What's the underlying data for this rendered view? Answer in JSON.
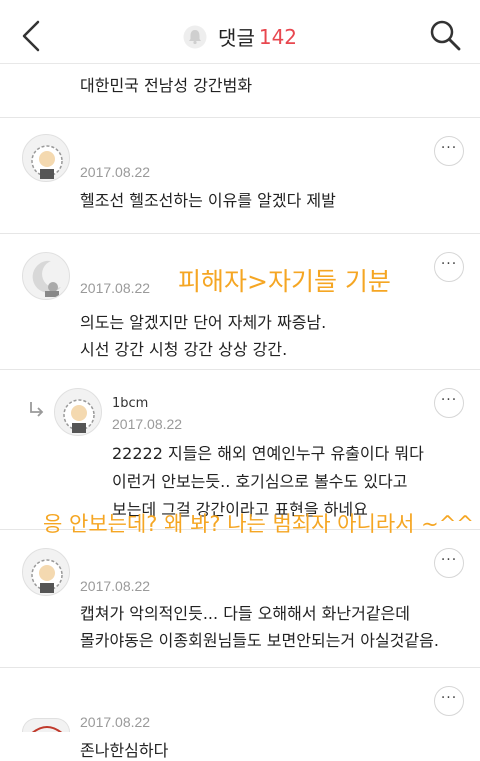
{
  "header": {
    "title": "댓글",
    "count": "142"
  },
  "comments": [
    {
      "body": "대한민국 전남성 강간범화"
    },
    {
      "date": "2017.08.22",
      "body": "헬조선 헬조선하는 이유를 알겠다 제발"
    },
    {
      "date": "2017.08.22",
      "body": "의도는 알겠지만 단어 자체가 짜증남.\n시선 강간 시청 강간 상상 강간."
    },
    {
      "author": "1bcm",
      "date": "2017.08.22",
      "body": "22222 지들은 해외 연예인누구 유출이다 뭐다\n이런거 안보는듯.. 호기심으로 볼수도 있다고\n보는데 그걸 강간이라고 표현을 하네요"
    },
    {
      "date": "2017.08.22",
      "body": "캡쳐가 악의적인듯... 다들 오해해서 화난거같은데\n몰카야동은 이종회원님들도 보면안되는거 아실것같음."
    },
    {
      "date": "2017.08.22",
      "body": "존나한심하다"
    }
  ],
  "overlays": {
    "first": "피해자>자기들 기분",
    "second": "응 안보는데? 왜 봐? 나는 범죄자 아니라서 ~^^"
  },
  "more_label": "···",
  "colors": {
    "accent_count": "#e8474f",
    "overlay_text": "#f5a623"
  },
  "icons": [
    "back-chevron-icon",
    "bell-icon",
    "search-icon",
    "more-icon",
    "reply-arrow-icon",
    "avatar-icon"
  ]
}
